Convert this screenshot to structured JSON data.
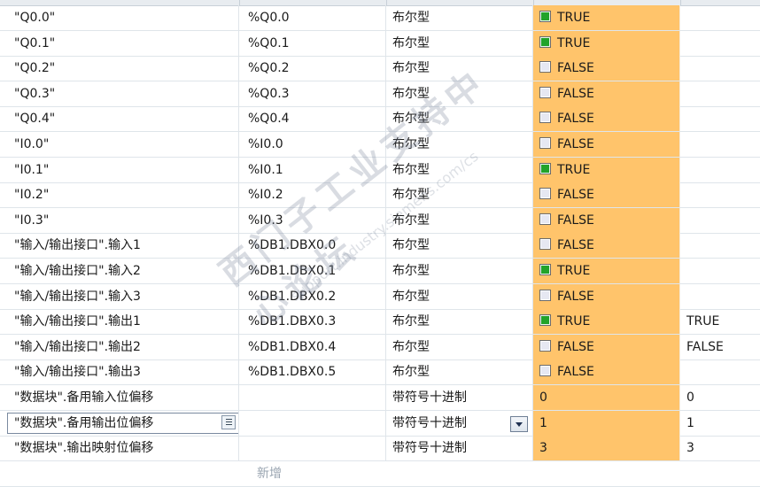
{
  "rows": [
    {
      "name": "\"Q0.0\"",
      "address": "%Q0.0",
      "type": "布尔型",
      "monitor": "TRUE",
      "state": "on",
      "modify": ""
    },
    {
      "name": "\"Q0.1\"",
      "address": "%Q0.1",
      "type": "布尔型",
      "monitor": "TRUE",
      "state": "on",
      "modify": ""
    },
    {
      "name": "\"Q0.2\"",
      "address": "%Q0.2",
      "type": "布尔型",
      "monitor": "FALSE",
      "state": "off",
      "modify": ""
    },
    {
      "name": "\"Q0.3\"",
      "address": "%Q0.3",
      "type": "布尔型",
      "monitor": "FALSE",
      "state": "off",
      "modify": ""
    },
    {
      "name": "\"Q0.4\"",
      "address": "%Q0.4",
      "type": "布尔型",
      "monitor": "FALSE",
      "state": "off",
      "modify": ""
    },
    {
      "name": "\"I0.0\"",
      "address": "%I0.0",
      "type": "布尔型",
      "monitor": "FALSE",
      "state": "off",
      "modify": ""
    },
    {
      "name": "\"I0.1\"",
      "address": "%I0.1",
      "type": "布尔型",
      "monitor": "TRUE",
      "state": "on",
      "modify": ""
    },
    {
      "name": "\"I0.2\"",
      "address": "%I0.2",
      "type": "布尔型",
      "monitor": "FALSE",
      "state": "off",
      "modify": ""
    },
    {
      "name": "\"I0.3\"",
      "address": "%I0.3",
      "type": "布尔型",
      "monitor": "FALSE",
      "state": "off",
      "modify": ""
    },
    {
      "name": "\"输入/输出接口\".输入1",
      "address": "%DB1.DBX0.0",
      "type": "布尔型",
      "monitor": "FALSE",
      "state": "off",
      "modify": ""
    },
    {
      "name": "\"输入/输出接口\".输入2",
      "address": "%DB1.DBX0.1",
      "type": "布尔型",
      "monitor": "TRUE",
      "state": "on",
      "modify": ""
    },
    {
      "name": "\"输入/输出接口\".输入3",
      "address": "%DB1.DBX0.2",
      "type": "布尔型",
      "monitor": "FALSE",
      "state": "off",
      "modify": ""
    },
    {
      "name": "\"输入/输出接口\".输出1",
      "address": "%DB1.DBX0.3",
      "type": "布尔型",
      "monitor": "TRUE",
      "state": "on",
      "modify": "TRUE"
    },
    {
      "name": "\"输入/输出接口\".输出2",
      "address": "%DB1.DBX0.4",
      "type": "布尔型",
      "monitor": "FALSE",
      "state": "off",
      "modify": "FALSE"
    },
    {
      "name": "\"输入/输出接口\".输出3",
      "address": "%DB1.DBX0.5",
      "type": "布尔型",
      "monitor": "FALSE",
      "state": "off",
      "modify": ""
    },
    {
      "name": "\"数据块\".备用输入位偏移",
      "address": "",
      "type": "带符号十进制",
      "monitor": "0",
      "state": "none",
      "modify": "0"
    },
    {
      "name": "\"数据块\".备用输出位偏移",
      "address": "",
      "type": "带符号十进制",
      "monitor": "1",
      "state": "none",
      "modify": "1"
    },
    {
      "name": "\"数据块\".输出映射位偏移",
      "address": "",
      "type": "带符号十进制",
      "monitor": "3",
      "state": "none",
      "modify": "3"
    }
  ],
  "add_new_label": "新增",
  "watermark": {
    "line1": "西门子工业支持中心论坛",
    "line2": "support.industry.siemens.com/cs"
  },
  "colors": {
    "monitor_bg": "#ffc46b",
    "true_box": "#22a32a",
    "false_box": "#e6e8f2"
  }
}
